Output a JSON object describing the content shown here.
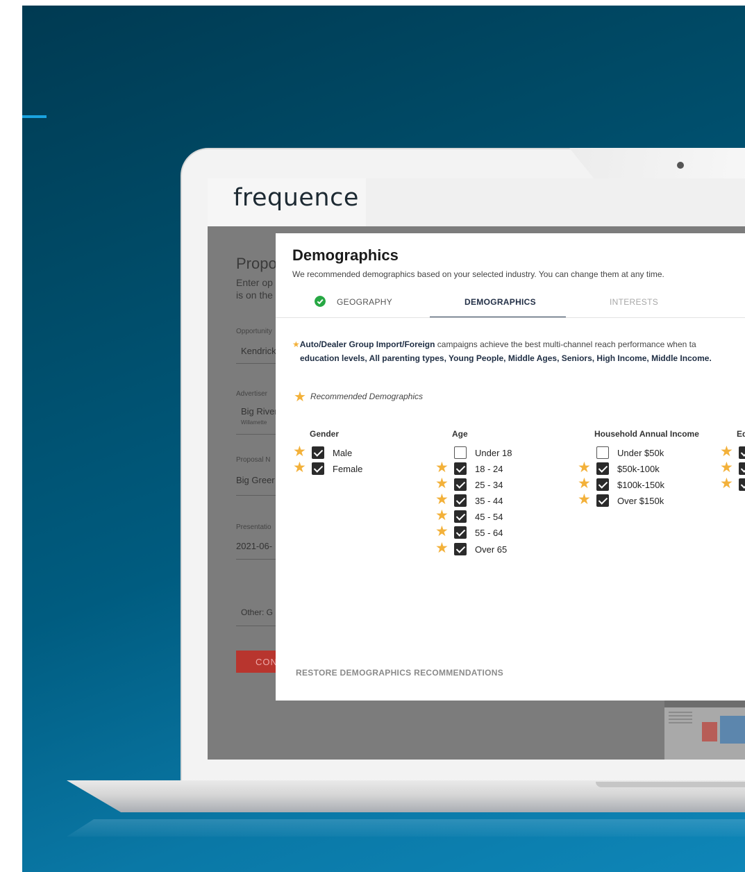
{
  "app": {
    "logo": "frequence"
  },
  "background_form": {
    "title": "Propo",
    "intro_line1": "Enter op",
    "intro_line2": "is on the",
    "fields": [
      {
        "label": "Opportunity",
        "value": "Kendrick"
      },
      {
        "label": "Advertiser",
        "value": "Big River",
        "sub": "Willamette"
      },
      {
        "label": "Proposal N",
        "value": "Big Greer"
      },
      {
        "label": "Presentatio",
        "value": "2021-06-"
      },
      {
        "label": "",
        "value": "Other: G"
      }
    ],
    "button_label": "CON"
  },
  "modal": {
    "title": "Demographics",
    "description": "We recommended demographics based on your selected industry. You can change them at any time.",
    "tabs": [
      {
        "label": "GEOGRAPHY",
        "state": "complete"
      },
      {
        "label": "DEMOGRAPHICS",
        "state": "active"
      },
      {
        "label": "INTERESTS",
        "state": "inactive"
      }
    ],
    "recommendation": {
      "industry": "Auto/Dealer Group Import/Foreign",
      "text_after_industry": " campaigns achieve the best multi-channel reach performance when ta",
      "line2": "education levels, All parenting types, Young People, Middle Ages, Seniors, High Income, Middle Income."
    },
    "legend_label": "Recommended Demographics",
    "columns": {
      "gender": {
        "title": "Gender",
        "options": [
          {
            "label": "Male",
            "checked": true,
            "recommended": true
          },
          {
            "label": "Female",
            "checked": true,
            "recommended": true
          }
        ]
      },
      "age": {
        "title": "Age",
        "options": [
          {
            "label": "Under 18",
            "checked": false,
            "recommended": false
          },
          {
            "label": "18 - 24",
            "checked": true,
            "recommended": true
          },
          {
            "label": "25 - 34",
            "checked": true,
            "recommended": true
          },
          {
            "label": "35 - 44",
            "checked": true,
            "recommended": true
          },
          {
            "label": "45 - 54",
            "checked": true,
            "recommended": true
          },
          {
            "label": "55 - 64",
            "checked": true,
            "recommended": true
          },
          {
            "label": "Over 65",
            "checked": true,
            "recommended": true
          }
        ]
      },
      "income": {
        "title": "Household Annual Income",
        "options": [
          {
            "label": "Under $50k",
            "checked": false,
            "recommended": false
          },
          {
            "label": "$50k-100k",
            "checked": true,
            "recommended": true
          },
          {
            "label": "$100k-150k",
            "checked": true,
            "recommended": true
          },
          {
            "label": "Over $150k",
            "checked": true,
            "recommended": true
          }
        ]
      },
      "education": {
        "title": "Ed",
        "options": [
          {
            "label": "",
            "checked": true,
            "recommended": true
          },
          {
            "label": "",
            "checked": true,
            "recommended": true
          },
          {
            "label": "",
            "checked": true,
            "recommended": true
          }
        ]
      }
    },
    "restore_label": "RESTORE DEMOGRAPHICS RECOMMENDATIONS"
  },
  "colors": {
    "background_gradient_start": "#003a52",
    "background_gradient_end": "#0e86b8",
    "accent_line": "#1aa3e0",
    "star": "#f3b13a",
    "check_green": "#27a844",
    "active_tab": "#233047",
    "cta_red": "#b8352e"
  },
  "icons": {
    "recommended": "star-icon",
    "geography_status": "check-circle-icon",
    "checkbox": "checkbox-icon"
  }
}
